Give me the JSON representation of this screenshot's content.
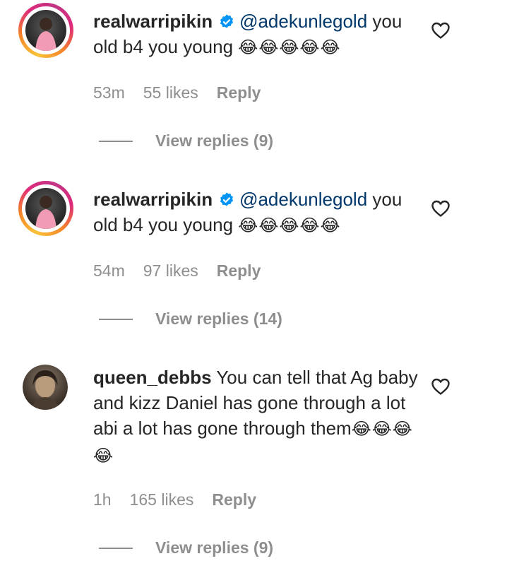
{
  "comments": [
    {
      "username": "realwarripikin",
      "mention": "@adekunlegold",
      "text": " you old b4 you young ",
      "emojis": "😂😂😂😂😂",
      "time": "53m",
      "likes": "55 likes",
      "reply_label": "Reply",
      "view_replies": "View replies (9)"
    },
    {
      "username": "realwarripikin",
      "mention": "@adekunlegold",
      "text": " you old b4 you young ",
      "emojis": "😂😂😂😂😂",
      "time": "54m",
      "likes": "97 likes",
      "reply_label": "Reply",
      "view_replies": "View replies (14)"
    },
    {
      "username": "queen_debbs",
      "text": " You can tell that Ag baby and kizz Daniel has gone through a lot abi a lot has gone through them",
      "emojis": "😂😂😂😂",
      "time": "1h",
      "likes": "165 likes",
      "reply_label": "Reply",
      "view_replies": "View replies (9)"
    }
  ],
  "icons": {
    "verified": "verified-badge-icon",
    "heart": "heart-outline-icon"
  },
  "colors": {
    "text": "#262626",
    "secondary": "#8e8e8e",
    "mention": "#00376b",
    "verified": "#0095f6"
  }
}
